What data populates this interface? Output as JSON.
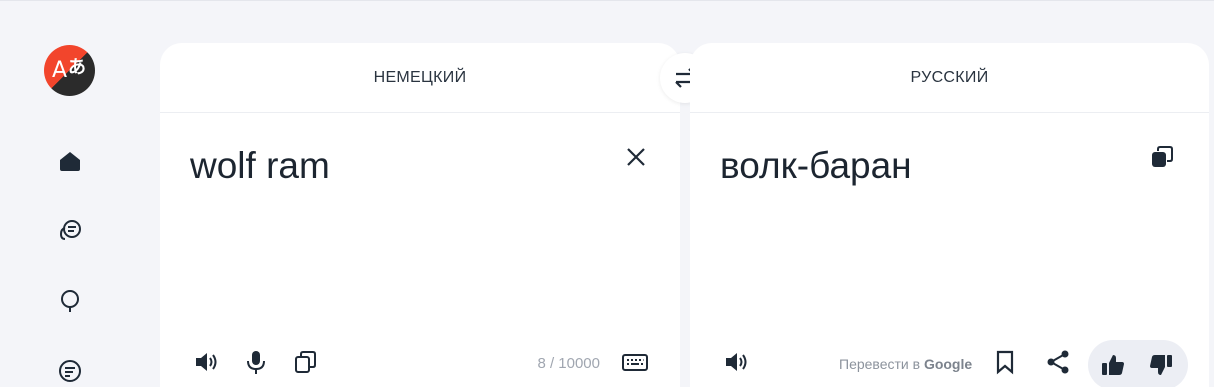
{
  "source": {
    "language": "НЕМЕЦКИЙ",
    "text": "wolf ram",
    "counter": "8 / 10000"
  },
  "target": {
    "language": "РУССКИЙ",
    "text": "волк-баран",
    "google_link_prefix": "Перевести в ",
    "google_link_brand": "Google"
  },
  "icons": {
    "logo": "translate-logo",
    "nav": [
      "home-icon",
      "chat-translate-icon",
      "bulb-icon",
      "document-icon"
    ],
    "source_tools": [
      "speaker-icon",
      "microphone-icon",
      "copy-icon",
      "keyboard-icon"
    ],
    "target_tools": [
      "speaker-icon",
      "bookmark-icon",
      "share-icon",
      "thumbs-up-icon",
      "thumbs-down-icon"
    ]
  },
  "colors": {
    "logo_red": "#f2452c",
    "logo_dark": "#2b2b2b",
    "background": "#f4f5f9",
    "icon": "#1f2a37"
  }
}
